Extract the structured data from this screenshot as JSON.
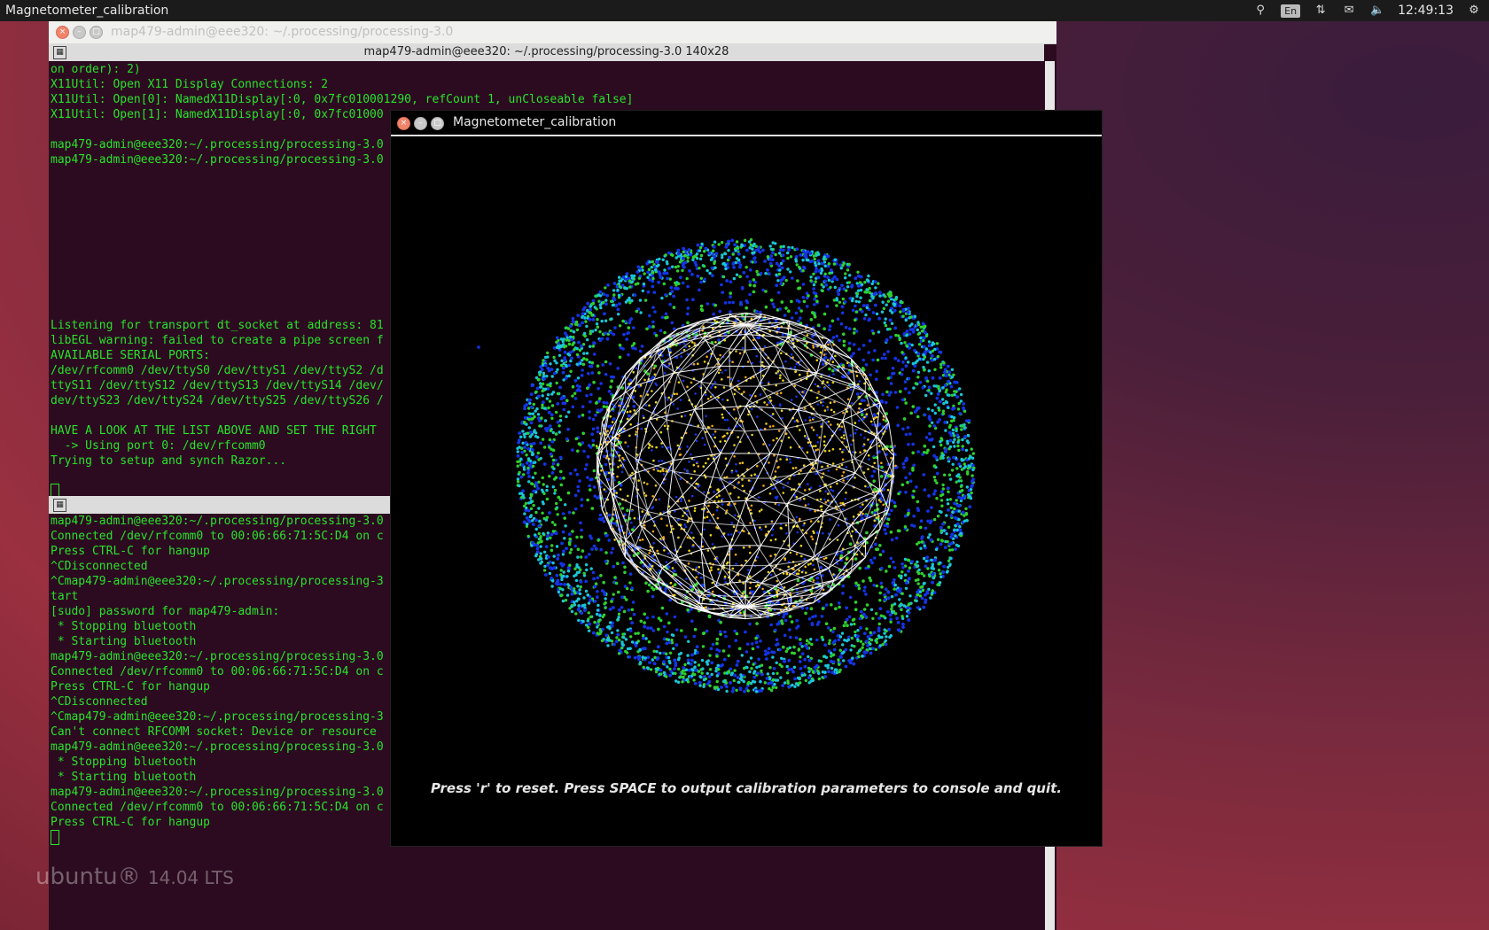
{
  "topbar": {
    "app_title": "Magnetometer_calibration",
    "lang": "En",
    "clock": "12:49:13",
    "icons": [
      "search-icon",
      "keyboard-layout-icon",
      "network-icon",
      "mail-icon",
      "volume-icon",
      "settings-icon"
    ]
  },
  "terminal": {
    "outer_title": "map479-admin@eee320: ~/.processing/processing-3.0",
    "inner_title": "map479-admin@eee320: ~/.processing/processing-3.0 140x28",
    "pane2_title": "m",
    "pane1_lines": [
      "on order): 2)",
      "X11Util: Open X11 Display Connections: 2",
      "X11Util: Open[0]: NamedX11Display[:0, 0x7fc010001290, refCount 1, unCloseable false]",
      "X11Util: Open[1]: NamedX11Display[:0, 0x7fc01000",
      "",
      "map479-admin@eee320:~/.processing/processing-3.0",
      "map479-admin@eee320:~/.processing/processing-3.0",
      "",
      "",
      "",
      "",
      "",
      "",
      "",
      "",
      "",
      "",
      "Listening for transport dt_socket at address: 81",
      "libEGL warning: failed to create a pipe screen f",
      "AVAILABLE SERIAL PORTS:",
      "/dev/rfcomm0 /dev/ttyS0 /dev/ttyS1 /dev/ttyS2 /d",
      "ttyS11 /dev/ttyS12 /dev/ttyS13 /dev/ttyS14 /dev/",
      "dev/ttyS23 /dev/ttyS24 /dev/ttyS25 /dev/ttyS26 /",
      "",
      "HAVE A LOOK AT THE LIST ABOVE AND SET THE RIGHT",
      "  -> Using port 0: /dev/rfcomm0",
      "Trying to setup and synch Razor...",
      ""
    ],
    "pane2_lines": [
      "map479-admin@eee320:~/.processing/processing-3.0",
      "Connected /dev/rfcomm0 to 00:06:66:71:5C:D4 on c",
      "Press CTRL-C for hangup",
      "^CDisconnected",
      "^Cmap479-admin@eee320:~/.processing/processing-3",
      "tart",
      "[sudo] password for map479-admin:",
      " * Stopping bluetooth",
      " * Starting bluetooth",
      "map479-admin@eee320:~/.processing/processing-3.0",
      "Connected /dev/rfcomm0 to 00:06:66:71:5C:D4 on c",
      "Press CTRL-C for hangup",
      "^CDisconnected",
      "^Cmap479-admin@eee320:~/.processing/processing-3",
      "Can't connect RFCOMM socket: Device or resource",
      "map479-admin@eee320:~/.processing/processing-3.0",
      " * Stopping bluetooth",
      " * Starting bluetooth",
      "map479-admin@eee320:~/.processing/processing-3.0",
      "Connected /dev/rfcomm0 to 00:06:66:71:5C:D4 on c",
      "Press CTRL-C for hangup"
    ]
  },
  "sketch": {
    "title": "Magnetometer_calibration",
    "hint": "Press 'r' to reset. Press SPACE to output calibration parameters to console and quit.",
    "colors": {
      "outer_cyan": "#19c6d8",
      "green": "#2ed12e",
      "blue": "#1434e6",
      "yellow": "#e8d21a",
      "orange": "#f0a416",
      "wire": "#ffffff"
    }
  },
  "desktop": {
    "watermark_brand": "ubuntu",
    "watermark_version": "14.04 LTS"
  }
}
